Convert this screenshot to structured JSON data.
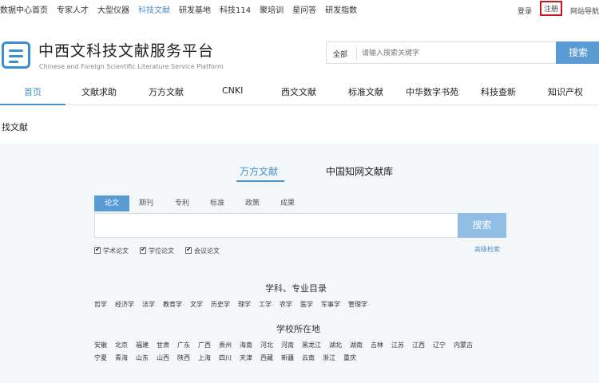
{
  "top_nav": {
    "items": [
      "数据中心首页",
      "专家人才",
      "大型仪器",
      "科技文献",
      "研发基地",
      "科技114",
      "聚培训",
      "星问答",
      "研发指数"
    ],
    "active_index": 3,
    "right": {
      "login": "登录",
      "register": "注册",
      "guide": "网站导航"
    }
  },
  "header": {
    "title": "中西文科技文献服务平台",
    "subtitle": "Chinese and Foreign Scientific Literature Service Platform",
    "search": {
      "scope": "全部",
      "placeholder": "请输入搜索关键字",
      "button": "搜索"
    }
  },
  "main_nav": {
    "items": [
      "首页",
      "文献求助",
      "万方文献",
      "CNKI",
      "西文文献",
      "标准文献",
      "中华数字书苑",
      "科技查新",
      "知识产权"
    ],
    "active_index": 0
  },
  "section": {
    "title": "找文献"
  },
  "panel": {
    "source_tabs": [
      "万方文献",
      "中国知网文献库"
    ],
    "type_tabs": [
      "论文",
      "期刊",
      "专利",
      "标准",
      "政策",
      "成果"
    ],
    "search_button": "搜索",
    "checkboxes": [
      "学术论文",
      "学位论文",
      "会议论文"
    ],
    "advanced": "高级检索",
    "subject_title": "学科、专业目录",
    "subjects": [
      "哲学",
      "经济学",
      "法学",
      "教育学",
      "文学",
      "历史学",
      "理学",
      "工学",
      "农学",
      "医学",
      "军事学",
      "管理学"
    ],
    "location_title": "学校所在地",
    "locations_row1": [
      "安徽",
      "北京",
      "福建",
      "甘肃",
      "广东",
      "广西",
      "贵州",
      "海南",
      "河北",
      "河南",
      "黑龙江",
      "湖北",
      "湖南",
      "吉林",
      "江苏",
      "江西",
      "辽宁",
      "内蒙古"
    ],
    "locations_row2": [
      "宁夏",
      "青海",
      "山东",
      "山西",
      "陕西",
      "上海",
      "四川",
      "天津",
      "西藏",
      "新疆",
      "云南",
      "浙江",
      "重庆"
    ]
  },
  "colors": {
    "accent": "#4a90c8",
    "button": "#5b9bd5",
    "highlight_border": "#d0121b"
  }
}
